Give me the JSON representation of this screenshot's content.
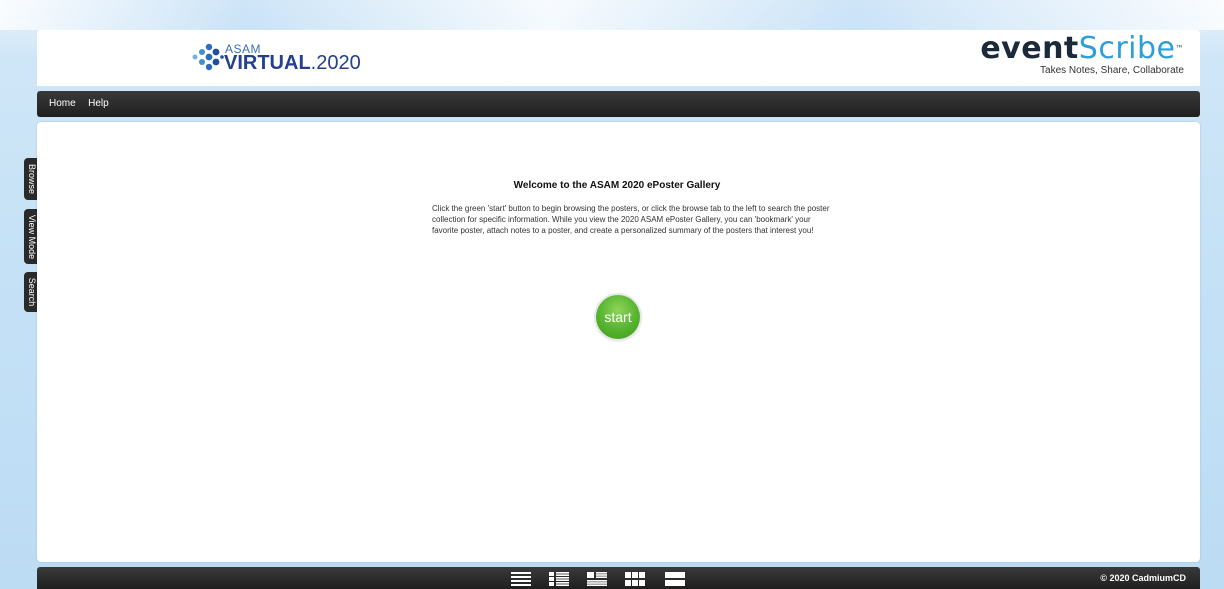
{
  "header": {
    "event_logo": {
      "small": "ASAM",
      "main": "VIRTUAL",
      "year": ".2020"
    },
    "brand_logo": {
      "event": "event",
      "scribe": "Scribe",
      "tm": "™",
      "tagline": "Takes Notes, Share, Collaborate"
    }
  },
  "nav": {
    "items": [
      "Home",
      "Help"
    ]
  },
  "side_tabs": [
    "Browse",
    "View Mode",
    "Search"
  ],
  "welcome": {
    "title": "Welcome to the ASAM 2020 ePoster Gallery",
    "body": "Click the green 'start' button to begin browsing the posters, or click the browse tab to the left to search the poster collection for specific information. While you view the 2020 ASAM ePoster Gallery, you can 'bookmark' your favorite poster, attach notes to a poster, and create a personalized summary of the posters that interest you!",
    "start_label": "start"
  },
  "footer": {
    "view_modes": [
      "list-view-icon",
      "detail-list-view-icon",
      "thumbnail-list-view-icon",
      "grid-view-icon",
      "single-view-icon"
    ],
    "copyright": "© 2020 CadmiumCD"
  },
  "colors": {
    "nav_bg": "#222222",
    "start_green": "#55b32e",
    "brand_blue": "#2c9fd9"
  }
}
